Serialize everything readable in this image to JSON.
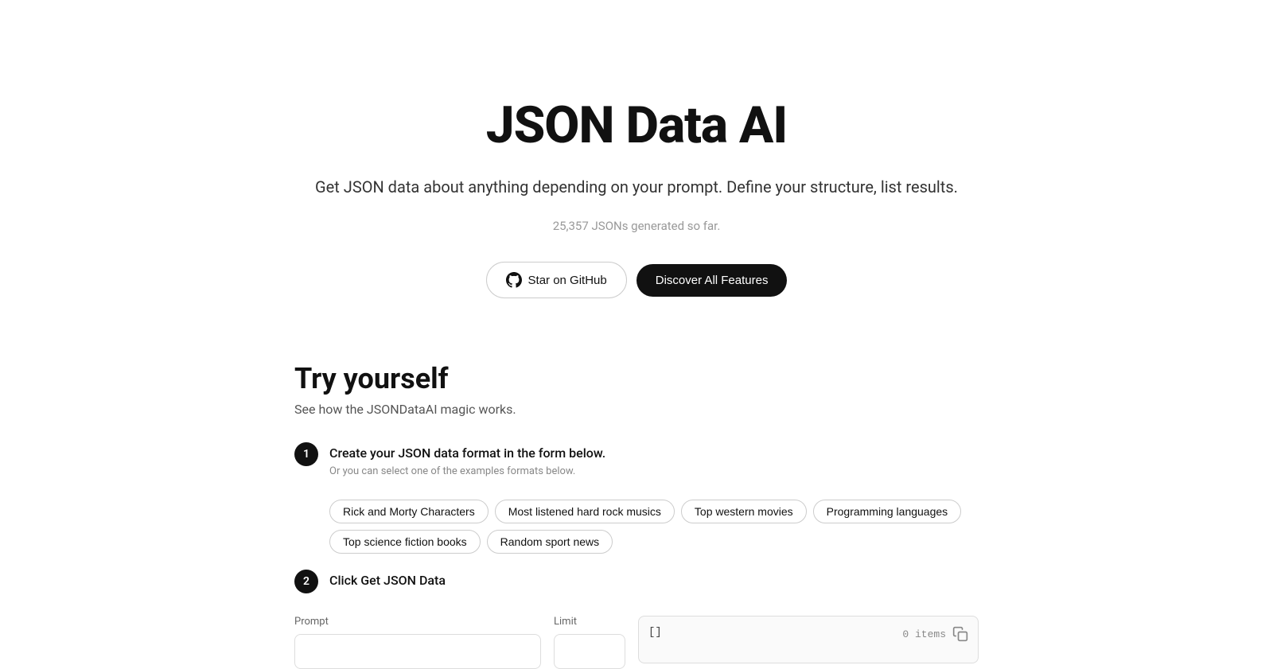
{
  "hero": {
    "title": "JSON Data AI",
    "subtitle": "Get JSON data about anything depending on your prompt. Define your structure, list results.",
    "stats": "25,357 JSONs generated so far.",
    "btn_github": "Star on GitHub",
    "btn_discover": "Discover All Features"
  },
  "try_section": {
    "title": "Try yourself",
    "subtitle": "See how the JSONDataAI magic works.",
    "step1_label": "Create your JSON data format in the form below.",
    "step1_hint": "Or you can select one of the examples formats below.",
    "step2_label": "Click Get JSON Data",
    "examples": [
      "Rick and Morty Characters",
      "Most listened hard rock musics",
      "Top western movies",
      "Programming languages",
      "Top science fiction books",
      "Random sport news"
    ]
  },
  "form": {
    "prompt_label": "Prompt",
    "prompt_placeholder": "",
    "limit_label": "Limit",
    "limit_placeholder": "",
    "json_initial": "[]",
    "items_count": "0 items"
  }
}
